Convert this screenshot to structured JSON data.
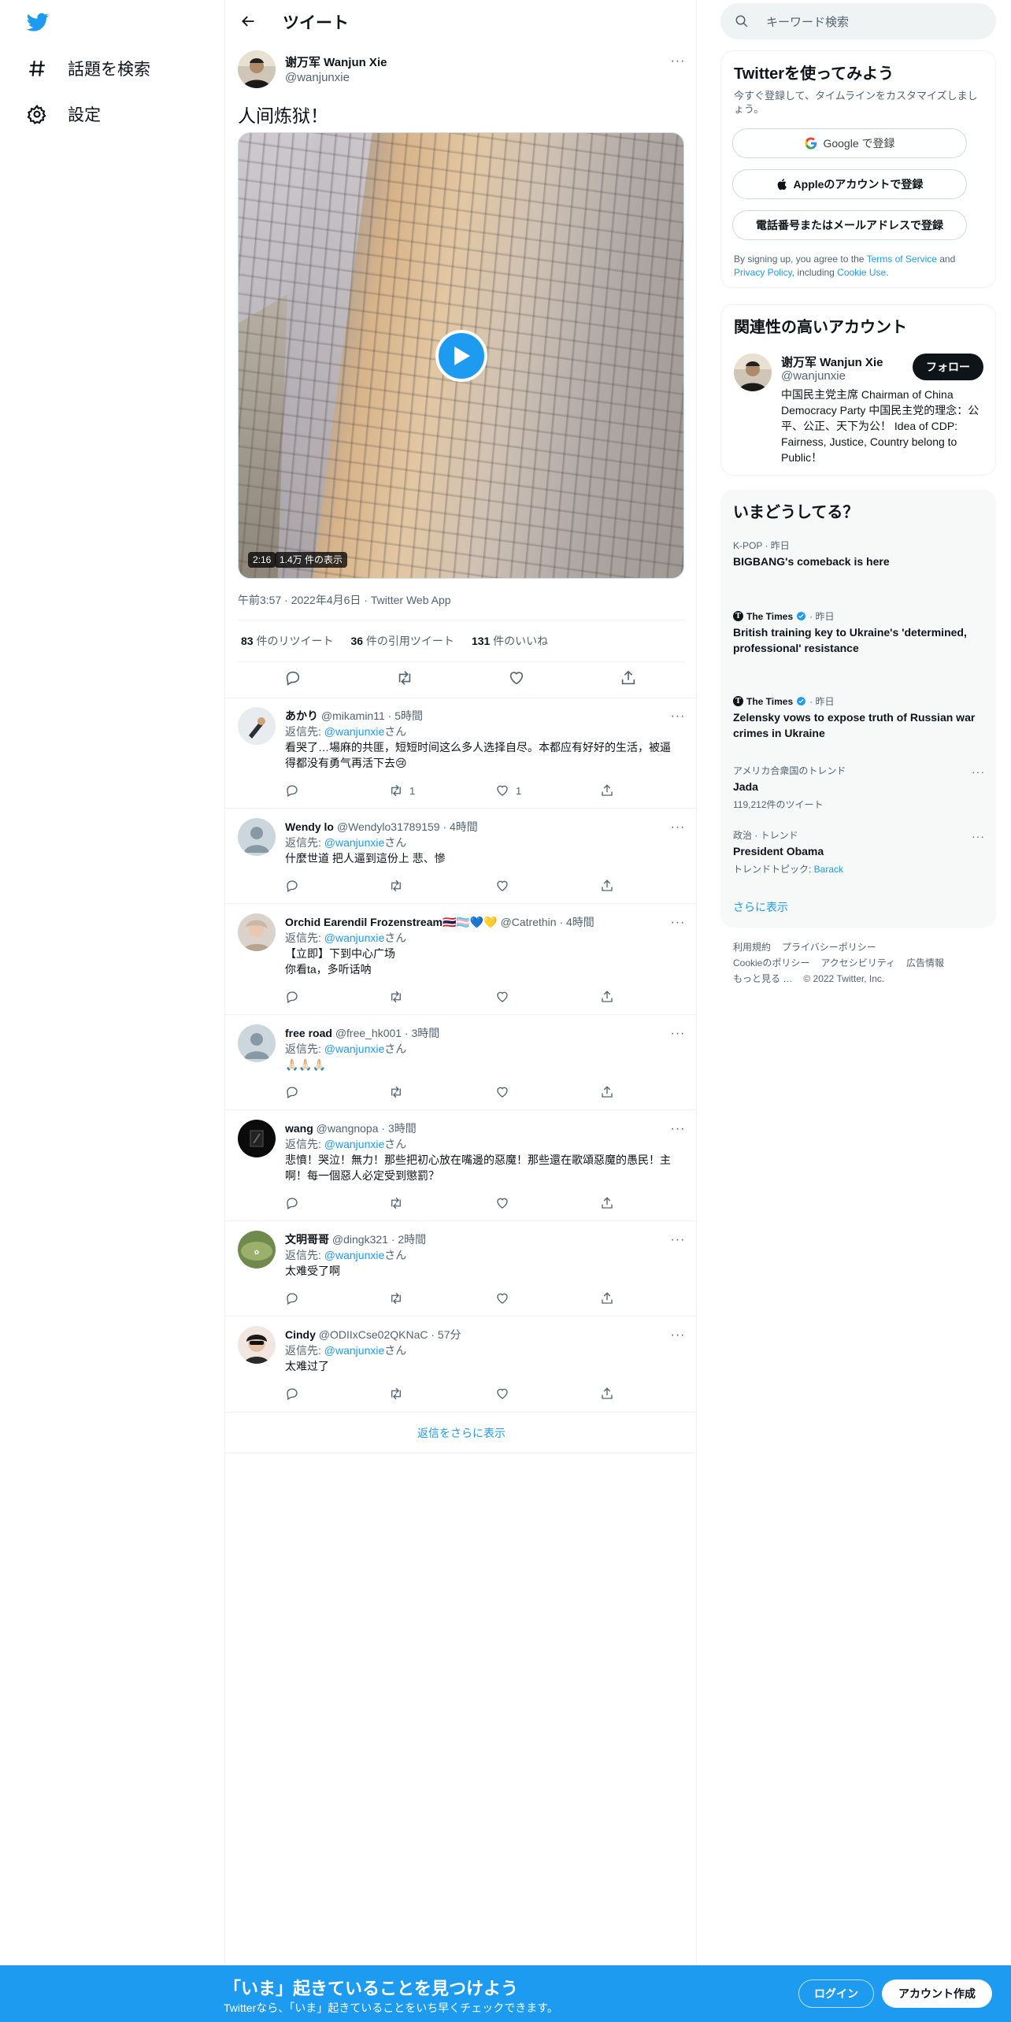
{
  "nav": {
    "explore_label": "話題を検索",
    "settings_label": "設定"
  },
  "header": {
    "title": "ツイート"
  },
  "tweet": {
    "author_name": "谢万军 Wanjun Xie",
    "author_handle": "@wanjunxie",
    "text": "人间炼狱！",
    "video_duration": "2:16",
    "video_views": "1.4万 件の表示",
    "meta": "午前3:57 · 2022年4月6日 · Twitter Web App",
    "retweets_count": "83",
    "retweets_label": " 件のリツイート",
    "quotes_count": "36",
    "quotes_label": " 件の引用ツイート",
    "likes_count": "131",
    "likes_label": " 件のいいね"
  },
  "reply_to_prefix": "返信先: ",
  "reply_to_handle": "@wanjunxie",
  "reply_to_suffix": "さん",
  "replies": [
    {
      "name": "あかり",
      "handle": "@mikamin11 · 5時間",
      "text": "看哭了…場麻的共匪，短短时间这么多人选择自尽。本都应有好好的生活，被逼得都没有勇气再活下去😢",
      "retweets": "1",
      "likes": "1"
    },
    {
      "name": "Wendy lo",
      "handle": "@Wendylo31789159 · 4時間",
      "text": "什麼世道 把人逼到這份上 悲、慘",
      "retweets": "",
      "likes": ""
    },
    {
      "name": "Orchid Earendil Frozenstream🇹🇭🏳️‍⚧️💙💛",
      "handle": "@Catrethin · 4時間",
      "text": "【立即】下到中心广场\n你看ta，多听话呐",
      "retweets": "",
      "likes": ""
    },
    {
      "name": "free road",
      "handle": "@free_hk001 · 3時間",
      "text": "🙏🏻🙏🏻🙏🏻",
      "retweets": "",
      "likes": ""
    },
    {
      "name": "wang",
      "handle": "@wangnopa · 3時間",
      "text": "悲憤！哭泣！無力！那些把初心放在嘴邊的惡魔！那些還在歌頌惡魔的愚民！主啊！每一個惡人必定受到懲罰？",
      "retweets": "",
      "likes": ""
    },
    {
      "name": "文明哥哥",
      "handle": "@dingk321 · 2時間",
      "text": "太难受了啊",
      "retweets": "",
      "likes": ""
    },
    {
      "name": "Cindy",
      "handle": "@ODIIxCse02QKNaC · 57分",
      "text": "太难过了",
      "retweets": "",
      "likes": ""
    }
  ],
  "show_more_replies": "返信をさらに表示",
  "search": {
    "placeholder": "キーワード検索"
  },
  "signup_card": {
    "title": "Twitterを使ってみよう",
    "subtitle": "今すぐ登録して、タイムラインをカスタマイズしましょう。",
    "google_label": "Google で登録",
    "apple_label": "Appleのアカウントで登録",
    "phone_label": "電話番号またはメールアドレスで登録",
    "terms_1": "By signing up, you agree to the ",
    "terms_link_1": "Terms of Service",
    "terms_2": " and ",
    "terms_link_2": "Privacy Policy",
    "terms_3": ", including ",
    "terms_link_3": "Cookie Use",
    "terms_4": "."
  },
  "related": {
    "title": "関連性の高いアカウント",
    "name": "谢万军 Wanjun Xie",
    "handle": "@wanjunxie",
    "follow_label": "フォロー",
    "bio": "中国民主党主席 Chairman of China Democracy Party 中国民主党的理念：公平、公正、天下为公！ Idea of CDP: Fairness, Justice, Country belong to Public！"
  },
  "trends": {
    "title": "いまどうしてる？",
    "items": [
      {
        "context": "K-POP · 昨日",
        "title": "BIGBANG's comeback is here",
        "sub": ""
      },
      {
        "context_source": "The Times",
        "context_time": " · 昨日",
        "title": "British training key to Ukraine's 'determined, professional' resistance"
      },
      {
        "context_source": "The Times",
        "context_time": " · 昨日",
        "title": "Zelensky vows to expose truth of Russian war crimes in Ukraine"
      },
      {
        "context": "アメリカ合衆国のトレンド",
        "title": "Jada",
        "sub": "119,212件のツイート"
      },
      {
        "context": "政治 · トレンド",
        "title": "President Obama",
        "sub_prefix": "トレンドトピック: ",
        "sub_link": "Barack"
      }
    ],
    "show_more": "さらに表示"
  },
  "footer": {
    "line1": [
      "利用規約",
      "プライバシーポリシー"
    ],
    "line2": [
      "Cookieのポリシー",
      "アクセシビリティ",
      "広告情報"
    ],
    "line3": [
      "もっと見る …",
      "© 2022 Twitter, Inc."
    ]
  },
  "bottom_bar": {
    "title": "「いま」起きていることを見つけよう",
    "subtitle": "Twitterなら、「いま」起きていることをいち早くチェックできます。",
    "login_label": "ログイン",
    "signup_label": "アカウント作成"
  },
  "colors": {
    "brand": "#1d9bf0",
    "text": "#0f1419",
    "muted": "#536471"
  },
  "icons": [
    "twitter-logo-icon",
    "hashtag-icon",
    "gear-icon",
    "back-arrow-icon",
    "search-icon",
    "reply-icon",
    "retweet-icon",
    "like-icon",
    "share-icon",
    "play-icon",
    "google-icon",
    "apple-icon",
    "verified-icon",
    "more-icon"
  ]
}
